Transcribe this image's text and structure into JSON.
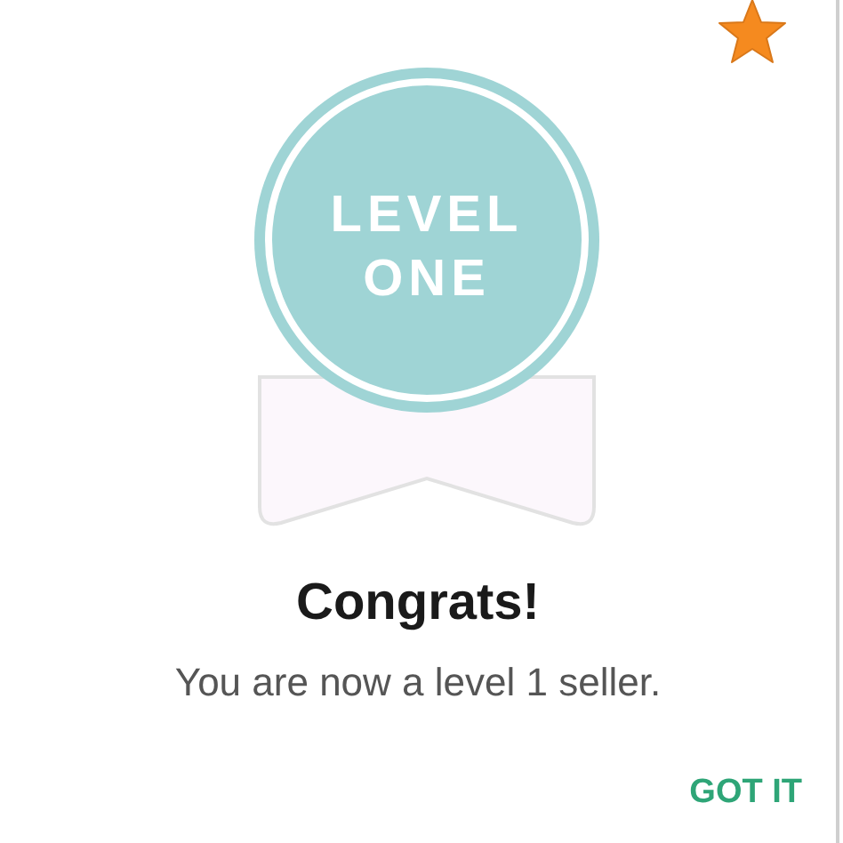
{
  "badge": {
    "label": "LEVEL ONE"
  },
  "title": "Congrats!",
  "message": "You are now a level 1 seller.",
  "buttons": [
    "GOT IT"
  ]
}
